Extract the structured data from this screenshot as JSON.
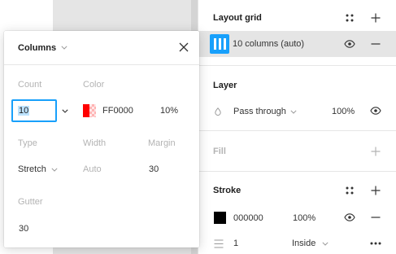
{
  "popover": {
    "title": "Columns",
    "count": {
      "label": "Count",
      "value": "10"
    },
    "color": {
      "label": "Color",
      "hex": "FF0000",
      "opacity": "10%",
      "swatch": "#ff0000"
    },
    "type": {
      "label": "Type",
      "value": "Stretch"
    },
    "width": {
      "label": "Width",
      "value": "Auto"
    },
    "margin": {
      "label": "Margin",
      "value": "30"
    },
    "gutter": {
      "label": "Gutter",
      "value": "30"
    }
  },
  "layout_grid": {
    "title": "Layout grid",
    "item_label": "10 columns (auto)"
  },
  "layer": {
    "title": "Layer",
    "blend_mode": "Pass through",
    "opacity": "100%"
  },
  "fill": {
    "title": "Fill"
  },
  "stroke": {
    "title": "Stroke",
    "hex": "000000",
    "opacity": "100%",
    "swatch": "#000000",
    "weight": "1",
    "position": "Inside"
  },
  "colors": {
    "accent": "#18a0fb",
    "selection": "#bde3ff"
  }
}
